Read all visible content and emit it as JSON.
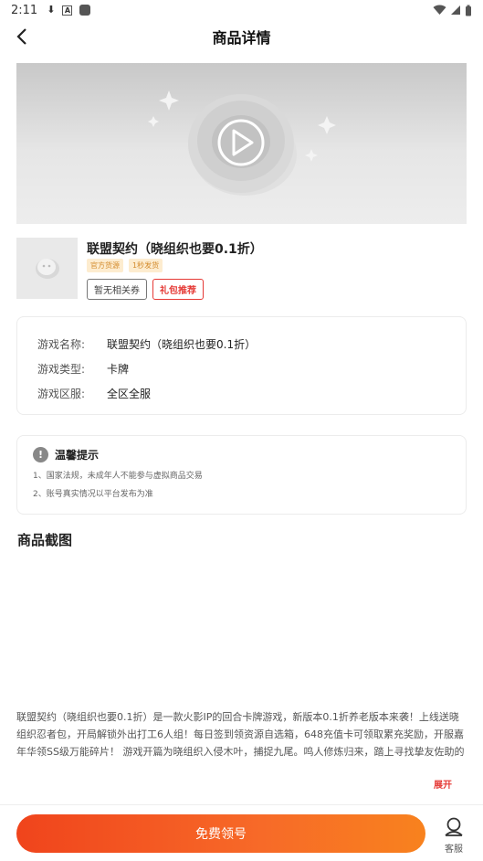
{
  "status_bar": {
    "time": "2:11"
  },
  "header": {
    "title": "商品详情"
  },
  "product": {
    "name": "联盟契约（晓组织也要0.1折）",
    "tags": [
      "官方货源",
      "1秒发货"
    ],
    "coupon_button": "暂无相关券",
    "gift_button": "礼包推荐"
  },
  "game_info": {
    "rows": [
      {
        "label": "游戏名称:",
        "value": "联盟契约（晓组织也要0.1折）"
      },
      {
        "label": "游戏类型:",
        "value": "卡牌"
      },
      {
        "label": "游戏区服:",
        "value": "全区全服"
      }
    ]
  },
  "tips": {
    "title": "温馨提示",
    "lines": [
      "1、国家法规，未成年人不能参与虚拟商品交易",
      "2、账号真实情况以平台发布为准"
    ]
  },
  "screenshots": {
    "title": "商品截图"
  },
  "description": {
    "text": "联盟契约（晓组织也要0.1折）是一款火影IP的回合卡牌游戏，新版本0.1折养老版本来袭！上线送晓组织忍者包，开局解锁外出打工6人组！每日签到领资源自选箱，648充值卡可领取累充奖励，开服嘉年华领SS级万能碎片！ 游戏开篇为晓组织入侵木叶，捕捉九尾。鸣人修炼归来，踏上寻找挚友佐助的旅途，收集百强忍者，轻松获取养成资源，只要能肝，SS...",
    "expand_label": "展开"
  },
  "bottom_bar": {
    "cta_label": "免费领号",
    "service_label": "客服"
  }
}
